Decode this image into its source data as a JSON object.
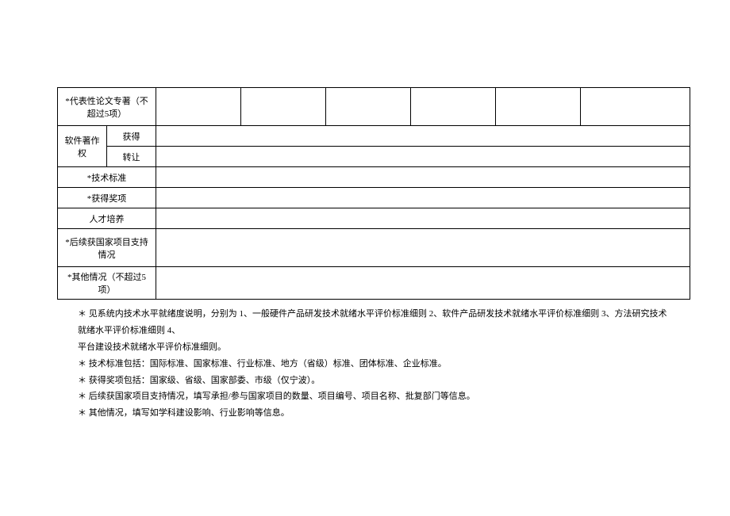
{
  "table": {
    "rows": [
      {
        "label": "*代表性论文专著（不超过5项）",
        "colspan_label": 2,
        "height": "taller-row"
      },
      {
        "label_l": "软件著作权",
        "label_r": "获得",
        "rowspan_l": 2
      },
      {
        "label_r": "转让"
      },
      {
        "label": "*技术标准",
        "colspan_label": 2
      },
      {
        "label": "*获得奖项",
        "colspan_label": 2
      },
      {
        "label": "人才培养",
        "colspan_label": 2
      },
      {
        "label": "*后续获国家项目支持情况",
        "colspan_label": 2,
        "height": "taller-row"
      },
      {
        "label": "*其他情况（不超过5项）",
        "colspan_label": 2
      }
    ]
  },
  "notes": {
    "line1_a": "＊ 见系统内技术水平就绪度说明，分别为 1、一般硬件产品研发技术就绪水平评价标准细则 2、软件产品研发技术就绪水平评价标准细则 3、方法研究技术就绪水平评价标准细则 4、",
    "line1_b": "平台建设技术就绪水平评价标准细则。",
    "line2": "＊ 技术标准包括：国际标准、国家标准、行业标准、地方（省级）标准、团体标准、企业标准。",
    "line3": "＊ 获得奖项包括：国家级、省级、国家部委、市级（仅宁波）。",
    "line4": "＊ 后续获国家项目支持情况，填写承担/参与国家项目的数量、项目编号、项目名称、批复部门等信息。",
    "line5": "＊ 其他情况，填写如学科建设影响、行业影响等信息。"
  }
}
